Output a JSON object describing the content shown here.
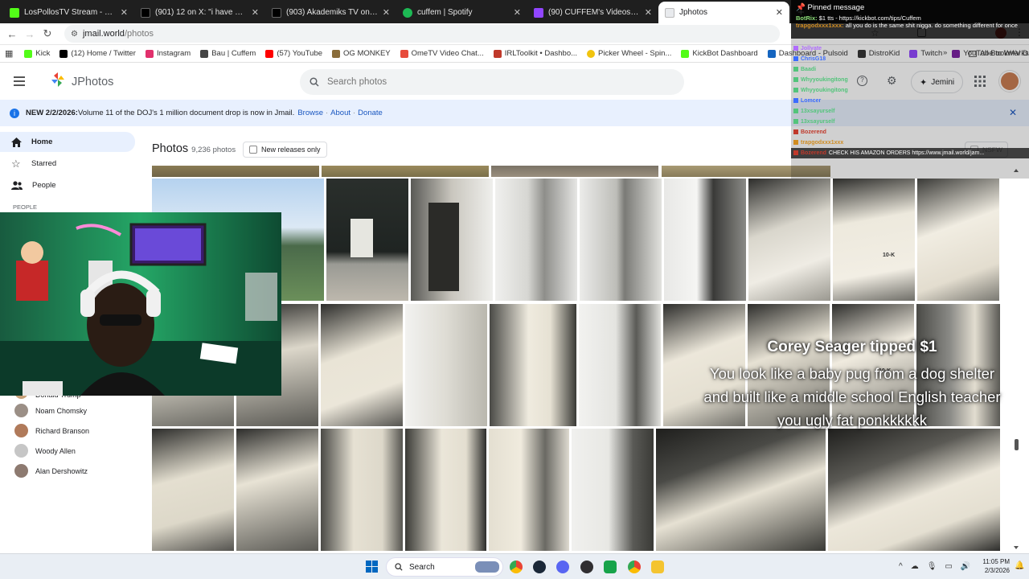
{
  "browser": {
    "tabs": [
      {
        "label": "LosPollosTV Stream - Watch Li",
        "color": "#53fc18"
      },
      {
        "label": "(901) 12 on X: \"i have boujee a",
        "color": "#000000"
      },
      {
        "label": "(903) Akademiks TV on X: \"Aka",
        "color": "#000000"
      },
      {
        "label": "cuffem | Spotify",
        "color": "#1db954"
      },
      {
        "label": "(90) CUFFEM's Videos - Twitch",
        "color": "#9146ff"
      },
      {
        "label": "Jphotos",
        "color": "#e8eaed"
      }
    ],
    "new_tab": "+",
    "url_host": "jmail.world",
    "url_path": "/photos",
    "bookmarks": [
      {
        "label": "Kick",
        "color": "#53fc18"
      },
      {
        "label": "(12) Home / Twitter",
        "color": "#000000"
      },
      {
        "label": "Instagram",
        "color": "#e1306c"
      },
      {
        "label": "Bau | Cuffem",
        "color": "#444444"
      },
      {
        "label": "(57) YouTube",
        "color": "#ff0000"
      },
      {
        "label": "OG MONKEY",
        "color": "#8a6d3b"
      },
      {
        "label": "OmeTV Video Chat...",
        "color": "#e74c3c"
      },
      {
        "label": "IRLToolkit • Dashbo...",
        "color": "#c0392b"
      },
      {
        "label": "Picker Wheel - Spin...",
        "color": "#f1c40f"
      },
      {
        "label": "KickBot Dashboard",
        "color": "#53fc18"
      },
      {
        "label": "Dashboard - Pulsoid",
        "color": "#1565c0"
      },
      {
        "label": "DistroKid",
        "color": "#333333"
      },
      {
        "label": "Twitch",
        "color": "#9146ff"
      },
      {
        "label": "YouTube to WAV D...",
        "color": "#7b1fa2"
      }
    ],
    "all_bookmarks": "All Bookmarks"
  },
  "app": {
    "name": "JPhotos",
    "search_placeholder": "Search photos",
    "jemini_label": "Jemini"
  },
  "banner": {
    "prefix": "NEW 2/2/2026:",
    "text": " Volume 11 of the DOJ's 1 million document drop is now in Jmail.",
    "links": [
      "Browse",
      "About",
      "Donate"
    ],
    "separator": "·"
  },
  "sidebar": {
    "items": [
      {
        "label": "Home",
        "icon": "home-icon",
        "active": true
      },
      {
        "label": "Starred",
        "icon": "star-icon",
        "active": false
      },
      {
        "label": "People",
        "icon": "people-icon",
        "active": false
      }
    ],
    "people_header": "PEOPLE",
    "people": [
      "Donald Trump",
      "Noam Chomsky",
      "Richard Branson",
      "Woody Allen",
      "Alan Dershowitz"
    ]
  },
  "main": {
    "title": "Photos",
    "count": "9,236 photos",
    "new_releases": "New releases only",
    "nsfw": "NSFW",
    "photo_text": [
      "10-K",
      "10-K"
    ]
  },
  "chat": {
    "pinned_title": "Pinned message",
    "pinned_user": "BotRix:",
    "pinned_text": "$1 tts - https://kickbot.com/tips/Cuffem",
    "top_user": "trapgodxxx1xxx:",
    "top_text": "all you do is the same shit nigga. do something different for once",
    "messages": [
      {
        "user": "Jollyate",
        "text": "",
        "color": "#b06cff"
      },
      {
        "user": "ChrisG18",
        "text": "",
        "color": "#3b6cff"
      },
      {
        "user": "Baadi",
        "text": "",
        "color": "#53c47b"
      },
      {
        "user": "Whyyoukingitong",
        "text": "",
        "color": "#53c47b"
      },
      {
        "user": "Whyyoukingitong",
        "text": "",
        "color": "#53c47b"
      },
      {
        "user": "Lomcer",
        "text": "",
        "color": "#3b6cff"
      },
      {
        "user": "13xsayurself",
        "text": "",
        "color": "#53c47b"
      },
      {
        "user": "13xsayurself",
        "text": "",
        "color": "#53c47b"
      },
      {
        "user": "Bozerend",
        "text": "",
        "color": "#c0392b"
      },
      {
        "user": "trapgodxxx1xxx",
        "text": "",
        "color": "#d08c20"
      },
      {
        "user": "Bozerend",
        "text": "CHECK HIS AMAZON ORDERS https://www.jmail.world/jam...",
        "color": "#c0392b"
      }
    ]
  },
  "tip": {
    "name": "Corey Seager tipped $1",
    "message": "You look like a baby pug from a dog shelter and built like a middle school English teacher you ugly fat ponkkkkkk"
  },
  "taskbar": {
    "search_label": "Search",
    "time": "11:05 PM",
    "date": "2/3/2026"
  }
}
